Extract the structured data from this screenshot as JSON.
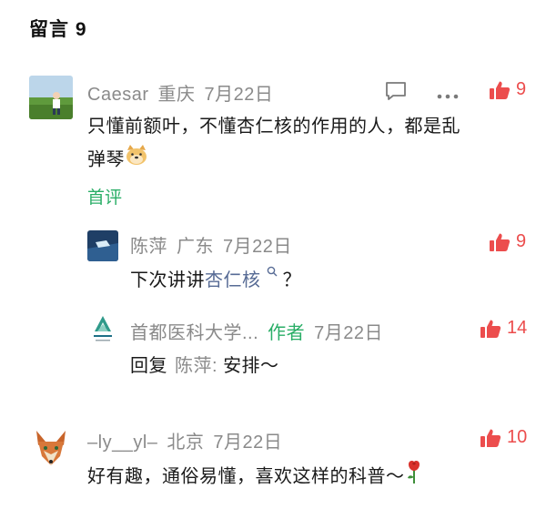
{
  "header": {
    "title": "留言 9"
  },
  "colors": {
    "like": "#ec4d4d",
    "author": "#2aae67",
    "link": "#576b95",
    "meta": "#8a8a8a"
  },
  "comments": [
    {
      "user": "Caesar",
      "location": "重庆",
      "date": "7月22日",
      "likes": "9",
      "text_line1": "只懂前额叶，不懂杏仁核的作用的人，都是乱",
      "text_line2": "弹琴",
      "text_emoji": "dog-face-emoji",
      "first_comment_label": "首评",
      "replies": [
        {
          "user": "陈萍",
          "location": "广东",
          "date": "7月22日",
          "likes": "9",
          "text_prefix": "下次讲讲",
          "text_link": "杏仁核",
          "text_suffix": "？"
        },
        {
          "user": "首都医科大学...",
          "author_tag": "作者",
          "date": "7月22日",
          "likes": "14",
          "text_prefix": "回复",
          "reply_to": "陈萍:",
          "text": "安排～"
        }
      ]
    },
    {
      "user": "–ly__yl–",
      "location": "北京",
      "date": "7月22日",
      "likes": "10",
      "text": "好有趣，通俗易懂，喜欢这样的科普～",
      "text_emoji": "rose-emoji"
    }
  ]
}
